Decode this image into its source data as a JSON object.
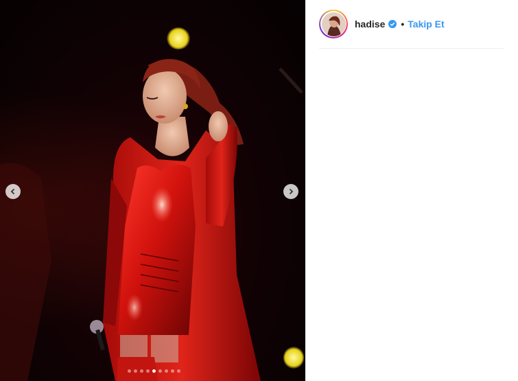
{
  "post": {
    "carousel": {
      "slide_count": 9,
      "active_index": 4
    }
  },
  "header": {
    "username": "hadise",
    "separator": "•",
    "follow_label": "Takip Et"
  },
  "colors": {
    "link": "#3897f0",
    "text": "#262626",
    "divider": "#efefef"
  },
  "icons": {
    "prev": "chevron-left-icon",
    "next": "chevron-right-icon",
    "verified": "verified-badge-icon"
  }
}
